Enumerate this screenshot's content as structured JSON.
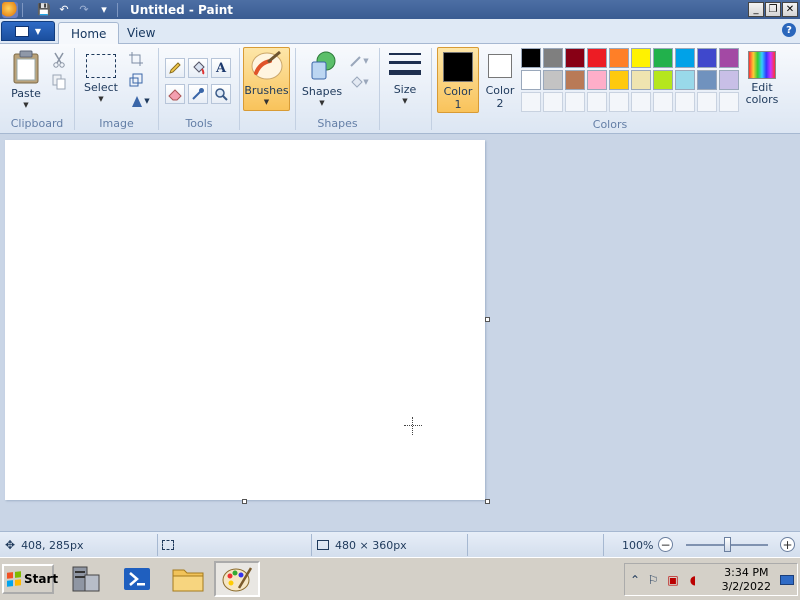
{
  "window": {
    "title": "Untitled - Paint",
    "controls": {
      "minimize": "_",
      "restore": "❐",
      "close": "✕"
    }
  },
  "quick_access": {
    "save": "💾",
    "undo": "↶",
    "redo": "↷",
    "more": "▾"
  },
  "ribbon_tabs": {
    "home": "Home",
    "view": "View",
    "help": "?"
  },
  "groups": {
    "clipboard": {
      "label": "Clipboard",
      "paste": "Paste"
    },
    "image": {
      "label": "Image",
      "select": "Select"
    },
    "tools": {
      "label": "Tools"
    },
    "brushes": {
      "label": "Brushes"
    },
    "shapes": {
      "label": "Shapes",
      "shapes_btn": "Shapes"
    },
    "size": {
      "label": "Size"
    },
    "colors": {
      "label": "Colors",
      "color1_line1": "Color",
      "color1_line2": "1",
      "color2_line1": "Color",
      "color2_line2": "2",
      "edit_line1": "Edit",
      "edit_line2": "colors",
      "color1_value": "#000000",
      "color2_value": "#ffffff",
      "palette": [
        "#000000",
        "#7f7f7f",
        "#880015",
        "#ed1c24",
        "#ff7f27",
        "#fff200",
        "#22b14c",
        "#00a2e8",
        "#3f48cc",
        "#a349a4",
        "#ffffff",
        "#c3c3c3",
        "#b97a57",
        "#ffaec9",
        "#ffc90e",
        "#efe4b0",
        "#b5e61d",
        "#99d9ea",
        "#7092be",
        "#c8bfe7",
        "",
        "",
        "",
        "",
        "",
        "",
        "",
        "",
        "",
        ""
      ]
    }
  },
  "statusbar": {
    "cursor_pos": "408, 285px",
    "selection_size": "",
    "canvas_size": "480 × 360px",
    "zoom": "100%",
    "zoom_level_percent": 100
  },
  "taskbar": {
    "start": "Start",
    "time": "3:34 PM",
    "date": "3/2/2022"
  }
}
